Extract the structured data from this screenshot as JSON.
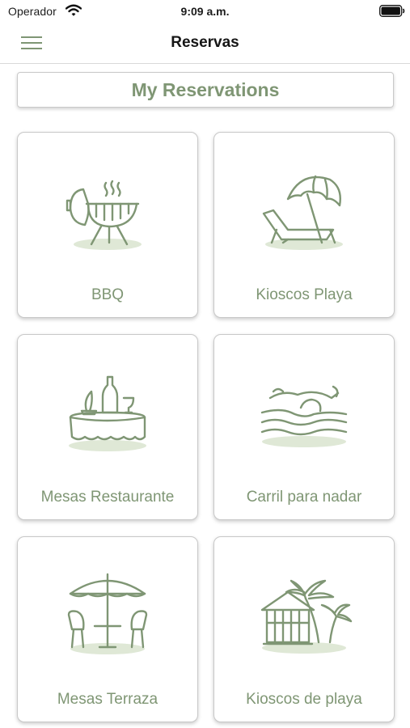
{
  "status_bar": {
    "carrier": "Operador",
    "time": "9:09 a.m."
  },
  "navbar": {
    "title": "Reservas",
    "menu_icon": "hamburger-menu-icon"
  },
  "my_reservations": {
    "label": "My Reservations"
  },
  "cards": [
    {
      "label": "BBQ",
      "icon": "bbq-grill-icon"
    },
    {
      "label": "Kioscos Playa",
      "icon": "beach-umbrella-icon"
    },
    {
      "label": "Mesas Restaurante",
      "icon": "restaurant-table-icon"
    },
    {
      "label": "Carril para nadar",
      "icon": "swimmer-icon"
    },
    {
      "label": "Mesas Terraza",
      "icon": "terrace-table-icon"
    },
    {
      "label": "Kioscos de playa",
      "icon": "beach-hut-icon"
    }
  ],
  "colors": {
    "accent": "#7f9674",
    "accent_light": "#dfe8d6",
    "card_border": "#c8c8c8"
  }
}
